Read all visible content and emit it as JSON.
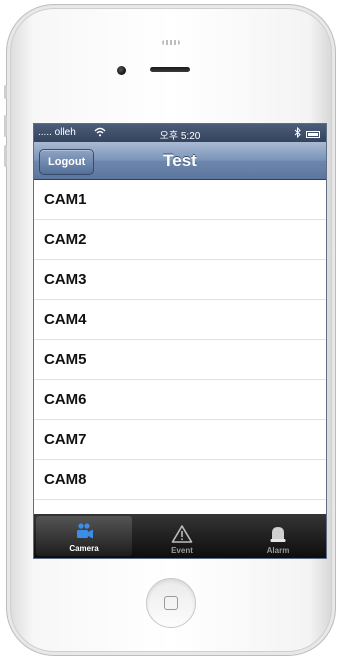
{
  "status_bar": {
    "carrier": "..... olleh",
    "time": "오후 5:20"
  },
  "nav_bar": {
    "title": "Test",
    "logout_label": "Logout"
  },
  "camera_list": [
    {
      "label": "CAM1"
    },
    {
      "label": "CAM2"
    },
    {
      "label": "CAM3"
    },
    {
      "label": "CAM4"
    },
    {
      "label": "CAM5"
    },
    {
      "label": "CAM6"
    },
    {
      "label": "CAM7"
    },
    {
      "label": "CAM8"
    }
  ],
  "tab_bar": {
    "selected": "camera",
    "tabs": [
      {
        "id": "camera",
        "label": "Camera",
        "icon": "video-camera-icon"
      },
      {
        "id": "event",
        "label": "Event",
        "icon": "warning-triangle-icon"
      },
      {
        "id": "alarm",
        "label": "Alarm",
        "icon": "alarm-bell-icon"
      }
    ]
  },
  "colors": {
    "nav_bar": "#6e87ac",
    "tab_bar": "#1a1a1a",
    "selected_tab_label": "#ffffff",
    "camera_icon": "#3b8ee8"
  }
}
